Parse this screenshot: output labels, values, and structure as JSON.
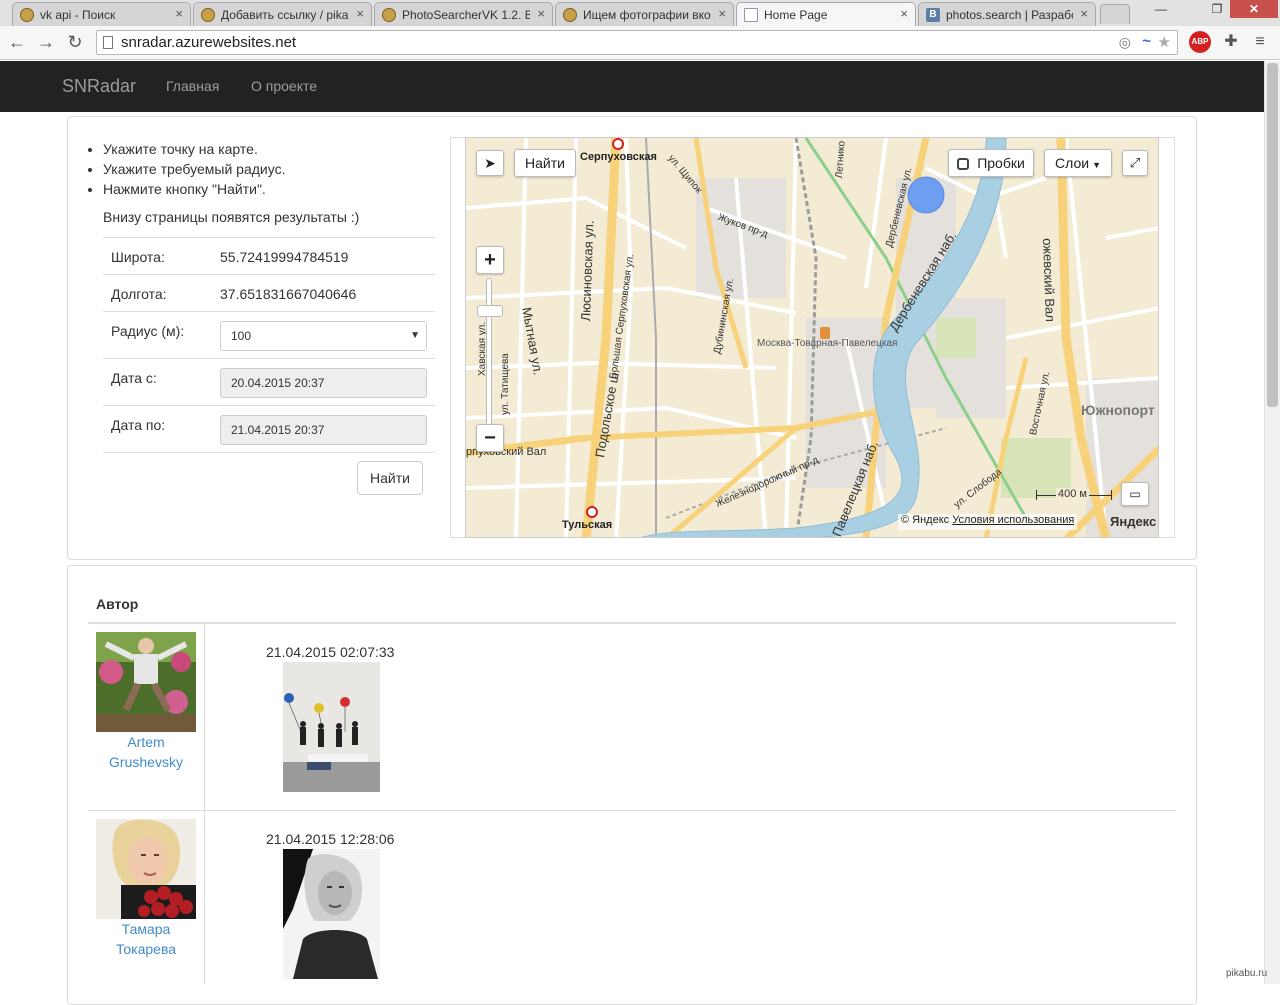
{
  "browser": {
    "tabs": [
      {
        "title": "vk api - Поиск",
        "icon": "pikabu-icon"
      },
      {
        "title": "Добавить ссылку / pikabu",
        "icon": "pikabu-icon"
      },
      {
        "title": "PhotoSearcherVK 1.2. B",
        "icon": "pikabu-icon"
      },
      {
        "title": "Ищем фотографии вконтакте",
        "icon": "pikabu-icon"
      },
      {
        "title": "Home Page",
        "icon": "page-icon",
        "active": true
      },
      {
        "title": "photos.search | Разработчикам",
        "icon": "vk-icon",
        "vk_letter": "B"
      }
    ],
    "close_glyph": "×",
    "url": "snradar.azurewebsites.net",
    "abp_label": "ABP"
  },
  "site": {
    "brand": "SNRadar",
    "nav": [
      "Главная",
      "О проекте"
    ]
  },
  "instructions": [
    "Укажите точку на карте.",
    "Укажите требуемый радиус.",
    "Нажмите кнопку \"Найти\"."
  ],
  "note": "Внизу страницы появятся результаты :)",
  "form": {
    "lat_label": "Широта:",
    "lat_value": "55.72419994784519",
    "lon_label": "Долгота:",
    "lon_value": "37.651831667040646",
    "radius_label": "Радиус (м):",
    "radius_value": "100",
    "date_from_label": "Дата с:",
    "date_from_value": "20.04.2015 20:37",
    "date_to_label": "Дата по:",
    "date_to_value": "21.04.2015 20:37",
    "find_label": "Найти"
  },
  "map": {
    "find_label": "Найти",
    "traffic_label": "Пробки",
    "layers_label": "Слои",
    "scale_label": "400 м",
    "copyright": "© Яндекс",
    "terms": "Условия использования",
    "logo": "Яндекс",
    "colors": {
      "river": "#a9cfe3",
      "road": "#f7d27a",
      "selection": "#6e9ef0"
    },
    "labels": {
      "serpukhovskaya": "Серпуховская",
      "tulskaya": "Тульская",
      "station": "Москва-Товарная-Павелецкая",
      "yuzhnoport": "Южнопорт",
      "lyusinovskaya": "Люсиновская ул.",
      "mytnaya": "Мытная ул.",
      "podolskoe": "Подольское ш.",
      "b_serpukh": "Большая Серпуховская ул.",
      "dubininskaya": "Дубининская ул.",
      "derbenev_nab": "Дербеневская наб.",
      "derbenev_ul": "Дербеневская ул.",
      "paveletskaya_nab": "Павелецкая наб.",
      "zhukov": "Жуков пр-д",
      "shchipok": "ул. Щипок",
      "zheleznodorozhny": "Железнодорожный пр-д",
      "khavskaya": "Хавская ул.",
      "tatishcheva": "ул. Татищева",
      "serpukhovsky_val": "рпуховский Вал",
      "vostochnaya": "Восточная ул.",
      "ozhevsky_val": "ожевский Вал",
      "sloboda": "ул. Слобода",
      "letnikovskaya": "Летнико"
    }
  },
  "results": {
    "header": "Автор",
    "items": [
      {
        "author": "Artem Grushevsky",
        "date": "21.04.2015 02:07:33"
      },
      {
        "author": "Тамара Токарева",
        "date": "21.04.2015 12:28:06"
      }
    ]
  },
  "watermark": "pikabu.ru"
}
